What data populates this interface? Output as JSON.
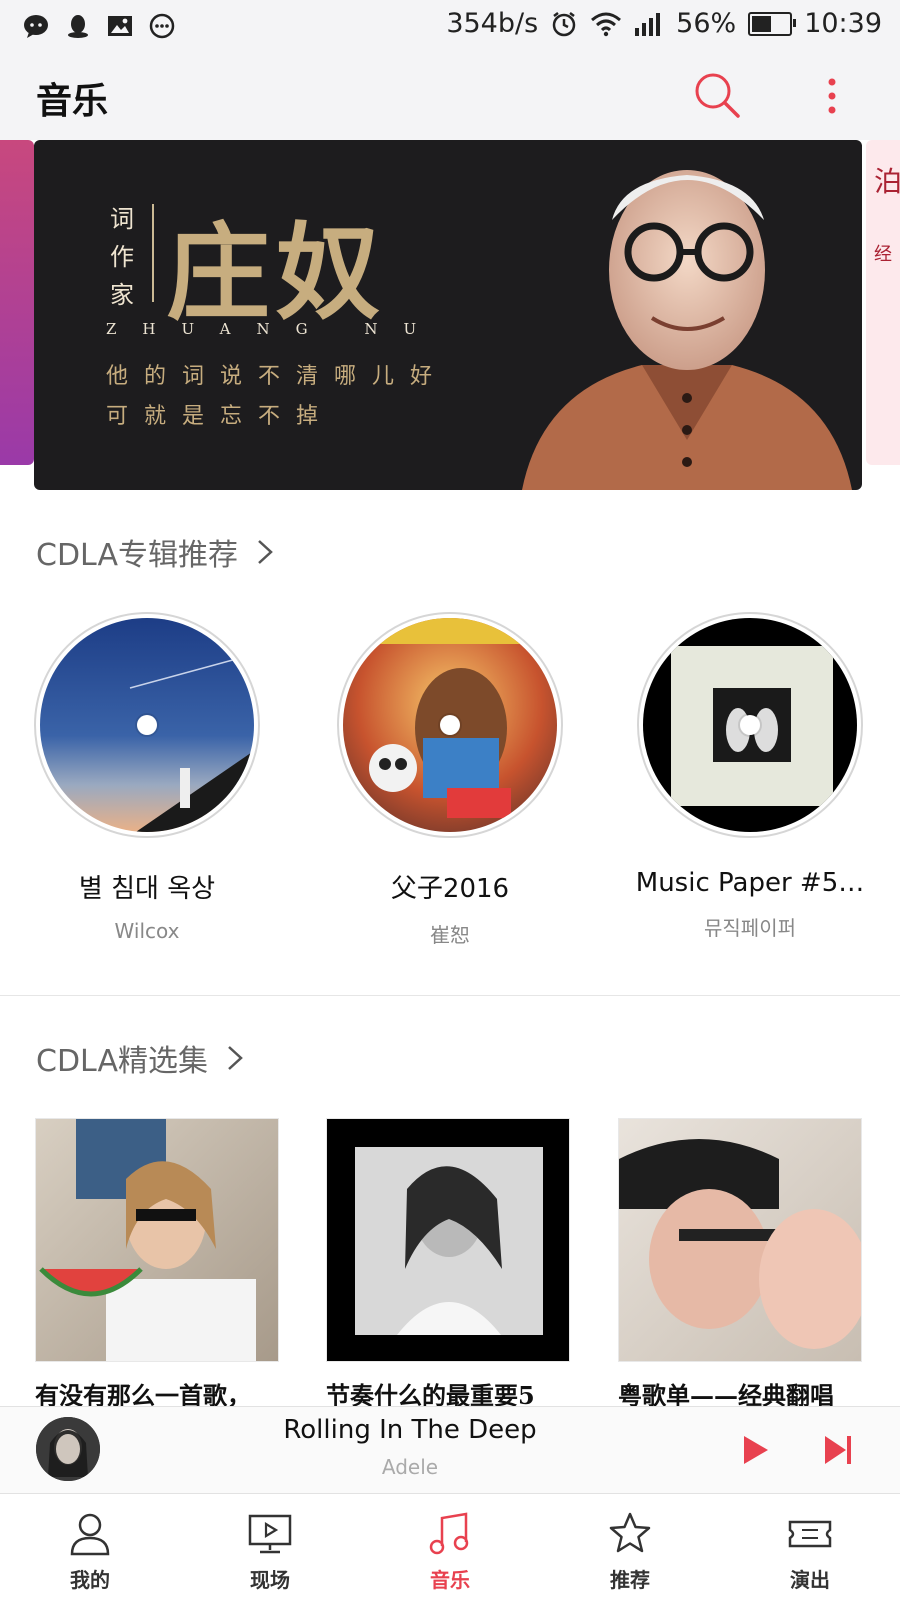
{
  "status_bar": {
    "speed": "354b/s",
    "battery": "56%",
    "battery_level": 0.56,
    "time": "10:39"
  },
  "app_bar": {
    "title": "音乐"
  },
  "banner": {
    "role": [
      "词",
      "作",
      "家"
    ],
    "name": "庄奴",
    "pinyin": "ZHUANG NU",
    "line1": "他的词说不清哪儿好",
    "line2": "可就是忘不掉"
  },
  "albums_section": {
    "title": "CDLA专辑推荐",
    "items": [
      {
        "title": "별 침대 옥상",
        "artist": "Wilcox"
      },
      {
        "title": "父子2016",
        "artist": "崔恕"
      },
      {
        "title": "Music Paper #5…",
        "artist": "뮤직페이퍼"
      }
    ]
  },
  "playlists_section": {
    "title": "CDLA精选集",
    "items": [
      {
        "caption": "有没有那么一首歌，"
      },
      {
        "caption": "节奏什么的最重要5"
      },
      {
        "caption": "粤歌单——经典翻唱"
      }
    ]
  },
  "player": {
    "song": "Rolling In The Deep",
    "artist": "Adele"
  },
  "nav": {
    "items": [
      {
        "label": "我的",
        "icon": "person-icon"
      },
      {
        "label": "现场",
        "icon": "tv-icon"
      },
      {
        "label": "音乐",
        "icon": "music-note-icon",
        "active": true
      },
      {
        "label": "推荐",
        "icon": "star-icon"
      },
      {
        "label": "演出",
        "icon": "ticket-icon"
      }
    ]
  },
  "colors": {
    "accent": "#e8414f",
    "banner_gold": "#c7ad7f",
    "banner_bg": "#1d1c1e"
  }
}
